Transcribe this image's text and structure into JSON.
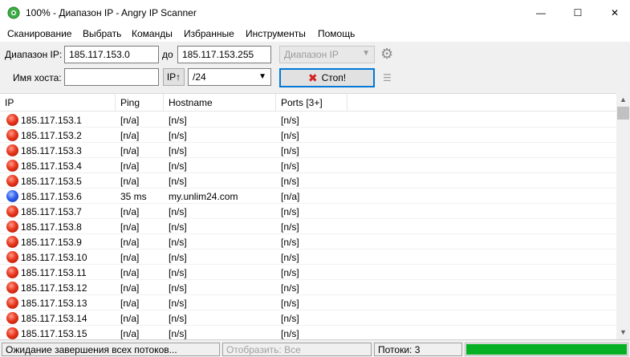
{
  "window": {
    "title": "100% - Диапазон IP - Angry IP Scanner",
    "controls": {
      "minimize": "—",
      "maximize": "☐",
      "close": "✕"
    }
  },
  "menu": [
    "Сканирование",
    "Выбрать",
    "Команды",
    "Избранные",
    "Инструменты",
    "Помощь"
  ],
  "toolbar": {
    "range_label": "Диапазон IP:",
    "range_start": "185.117.153.0",
    "to_label": "до",
    "range_end": "185.117.153.255",
    "feeder_select": "Диапазон IP",
    "hostname_label": "Имя хоста:",
    "hostname_value": "",
    "ip_button": "IP↑",
    "netmask_select": "/24",
    "stop_button": "Стоп!"
  },
  "table": {
    "columns": [
      "IP",
      "Ping",
      "Hostname",
      "Ports [3+]"
    ],
    "rows": [
      {
        "status": "red",
        "ip": "185.117.153.1",
        "ping": "[n/a]",
        "hostname": "[n/s]",
        "ports": "[n/s]"
      },
      {
        "status": "red",
        "ip": "185.117.153.2",
        "ping": "[n/a]",
        "hostname": "[n/s]",
        "ports": "[n/s]"
      },
      {
        "status": "red",
        "ip": "185.117.153.3",
        "ping": "[n/a]",
        "hostname": "[n/s]",
        "ports": "[n/s]"
      },
      {
        "status": "red",
        "ip": "185.117.153.4",
        "ping": "[n/a]",
        "hostname": "[n/s]",
        "ports": "[n/s]"
      },
      {
        "status": "red",
        "ip": "185.117.153.5",
        "ping": "[n/a]",
        "hostname": "[n/s]",
        "ports": "[n/s]"
      },
      {
        "status": "blue",
        "ip": "185.117.153.6",
        "ping": "35 ms",
        "hostname": "my.unlim24.com",
        "ports": "[n/a]"
      },
      {
        "status": "red",
        "ip": "185.117.153.7",
        "ping": "[n/a]",
        "hostname": "[n/s]",
        "ports": "[n/s]"
      },
      {
        "status": "red",
        "ip": "185.117.153.8",
        "ping": "[n/a]",
        "hostname": "[n/s]",
        "ports": "[n/s]"
      },
      {
        "status": "red",
        "ip": "185.117.153.9",
        "ping": "[n/a]",
        "hostname": "[n/s]",
        "ports": "[n/s]"
      },
      {
        "status": "red",
        "ip": "185.117.153.10",
        "ping": "[n/a]",
        "hostname": "[n/s]",
        "ports": "[n/s]"
      },
      {
        "status": "red",
        "ip": "185.117.153.11",
        "ping": "[n/a]",
        "hostname": "[n/s]",
        "ports": "[n/s]"
      },
      {
        "status": "red",
        "ip": "185.117.153.12",
        "ping": "[n/a]",
        "hostname": "[n/s]",
        "ports": "[n/s]"
      },
      {
        "status": "red",
        "ip": "185.117.153.13",
        "ping": "[n/a]",
        "hostname": "[n/s]",
        "ports": "[n/s]"
      },
      {
        "status": "red",
        "ip": "185.117.153.14",
        "ping": "[n/a]",
        "hostname": "[n/s]",
        "ports": "[n/s]"
      },
      {
        "status": "red",
        "ip": "185.117.153.15",
        "ping": "[n/a]",
        "hostname": "[n/s]",
        "ports": "[n/s]"
      }
    ]
  },
  "status": {
    "message": "Ожидание завершения всех потоков...",
    "display_filter": "Отобразить: Все",
    "threads": "Потоки: 3",
    "progress_fraction": 1.0,
    "progress_color": "#06b025"
  },
  "colors": {
    "alive_dot": "#2f5ff0",
    "dead_dot": "#e8371d",
    "stop_icon": "#d32020",
    "focus_border": "#0078d7"
  }
}
